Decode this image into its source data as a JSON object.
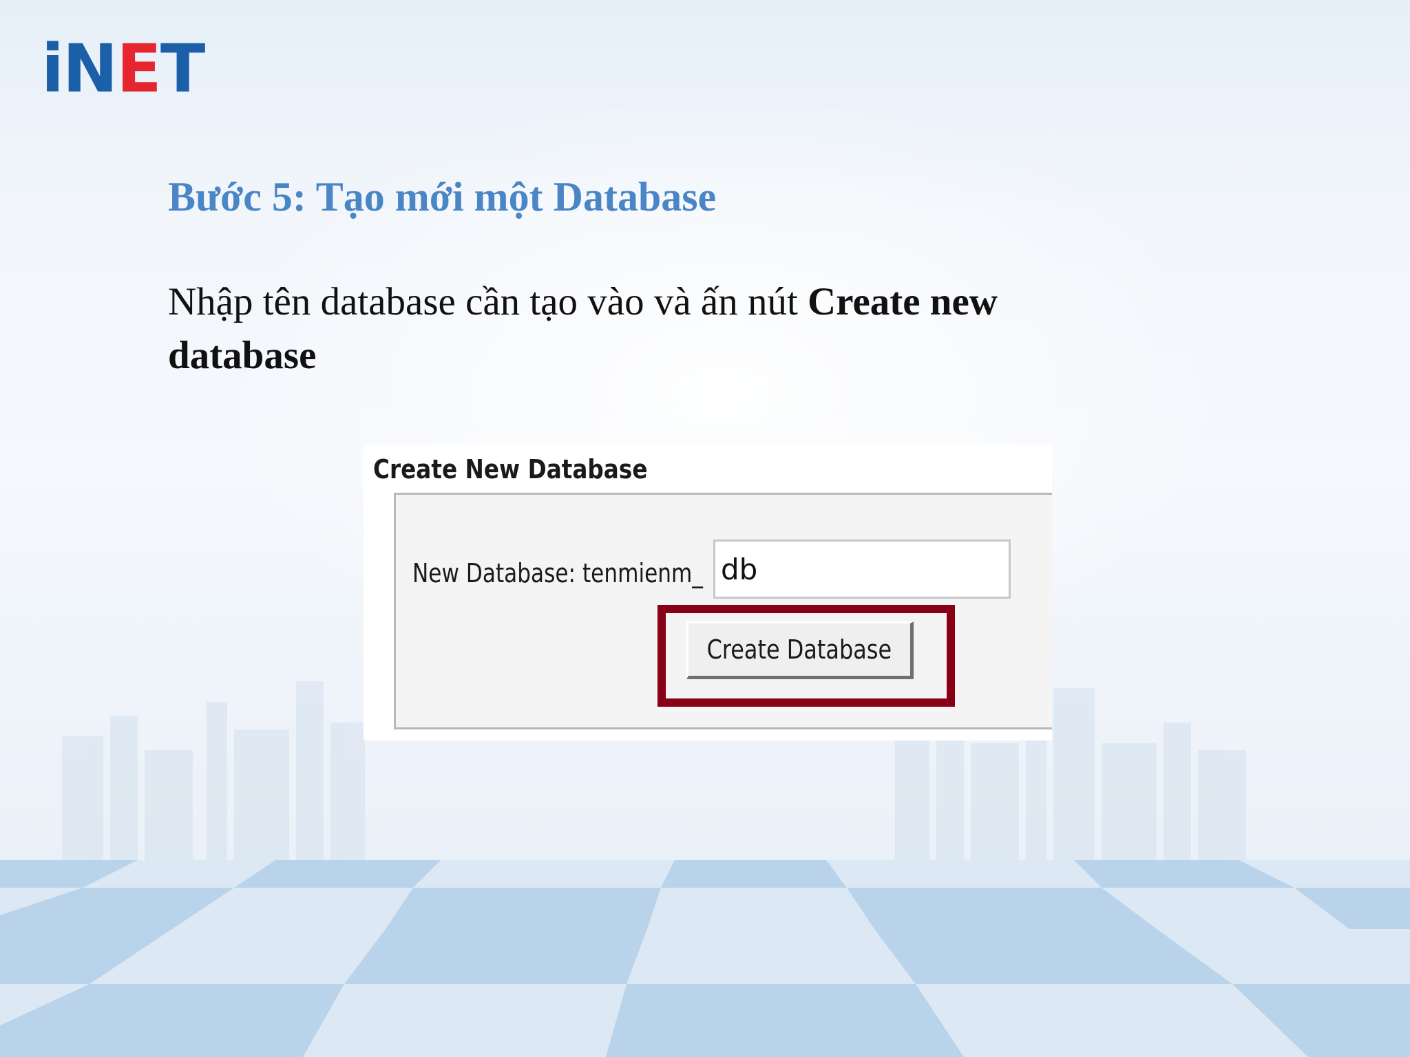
{
  "brand": {
    "logo": {
      "i": "i",
      "n": "N",
      "e": "E",
      "t": "T"
    }
  },
  "slide": {
    "title": "Bước 5: Tạo mới một Database",
    "instruction": {
      "text": "Nhập tên database cần tạo vào và ấn nút ",
      "emphasis": "Create new database"
    }
  },
  "form": {
    "heading": "Create New Database",
    "field_label": "New Database: tenmienm_",
    "field_value": "db",
    "button_label": "Create Database"
  },
  "colors": {
    "title_blue": "#4a86c5",
    "logo_blue": "#1b5fa8",
    "logo_red": "#e6262e",
    "highlight": "#870016"
  }
}
